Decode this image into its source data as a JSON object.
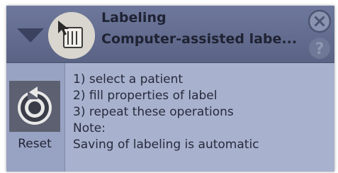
{
  "header": {
    "title": "Labeling",
    "subtitle": "Computer-assisted labe...",
    "module_icon": "grid-table-icon",
    "collapse_icon": "triangle-down-icon",
    "close_icon": "close-icon",
    "help_icon": "question-mark-icon",
    "help_label": "?"
  },
  "reset": {
    "label": "Reset",
    "icon": "reset-arrow-icon"
  },
  "instructions": [
    "1) select a patient",
    "2) fill properties of label",
    "3) repeat these operations",
    "Note:",
    "Saving of labeling is automatic"
  ],
  "colors": {
    "header_bg": "#5f6989",
    "body_bg": "#98a3c3",
    "text_area_bg": "#a8b1cd",
    "text": "#262a3c"
  }
}
